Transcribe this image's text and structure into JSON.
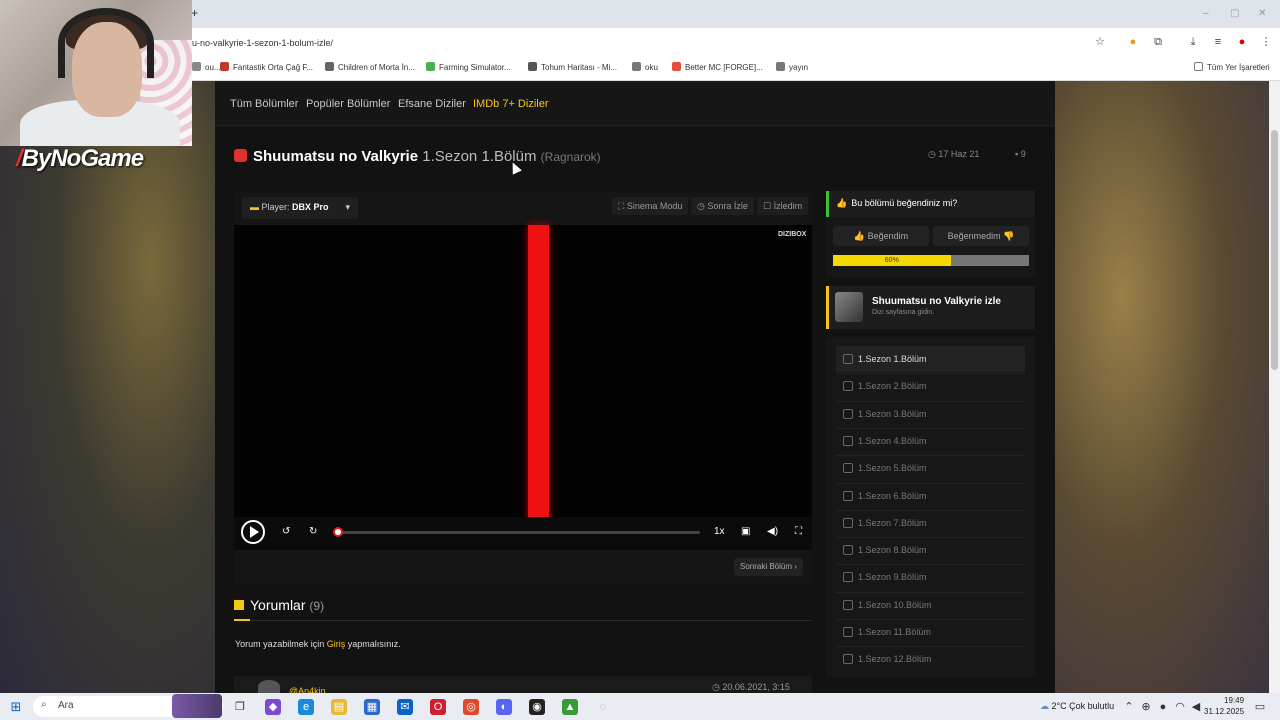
{
  "browser": {
    "url": "u-no-valkyrie-1-sezon-1-bolum-izle/",
    "bookmarks": [
      {
        "label": "ou...",
        "color": "#888888"
      },
      {
        "label": "Fantastik Orta Çağ F...",
        "color": "#c0392b"
      },
      {
        "label": "Children of Morta İn...",
        "color": "#666666"
      },
      {
        "label": "Farming Simulator...",
        "color": "#4caf50"
      },
      {
        "label": "Tohum Haritası - Mi...",
        "color": "#555555"
      },
      {
        "label": "oku",
        "color": "#777777"
      },
      {
        "label": "Better MC [FORGE]...",
        "color": "#e74c3c"
      },
      {
        "label": "yayın",
        "color": "#777777"
      }
    ],
    "all_bookmarks": "Tüm Yer İşaretleri"
  },
  "overlay": {
    "logo": "ByNoGame"
  },
  "nav": {
    "links": [
      "Tüm Bölümler",
      "Popüler Bölümler",
      "Efsane Diziler",
      "IMDb 7+ Diziler"
    ]
  },
  "episode": {
    "show": "Shuumatsu no Valkyrie",
    "season_ep": "1.Sezon 1.Bölüm",
    "subtitle": "(Ragnarok)",
    "date": "17 Haz 21",
    "comment_count": "9"
  },
  "player": {
    "label": "Player:",
    "name": "DBX Pro",
    "buttons": [
      "Sinema Modu",
      "Sonra İzle",
      "İzledim"
    ],
    "brand": "DIZIBOX",
    "speed": "1x",
    "next": "Sonraki Bölüm ›",
    "progress_fraction": 0.0
  },
  "comments": {
    "title": "Yorumlar",
    "count": "(9)",
    "note_before": "Yorum yazabilmek için ",
    "note_link": "Giriş",
    "note_after": " yapmalısınız.",
    "first_user": "@An4kin",
    "first_date": "20.06.2021, 3:15"
  },
  "rating": {
    "question": "Bu bölümü beğendiniz mi?",
    "like": "Beğendim",
    "dislike": "Beğenmedim",
    "percent_label": "60%",
    "percent": 60
  },
  "series_card": {
    "title": "Shuumatsu no Valkyrie izle",
    "sub": "Dizi sayfasına gidin."
  },
  "episodes": [
    "1.Sezon 1.Bölüm",
    "1.Sezon 2.Bölüm",
    "1.Sezon 3.Bölüm",
    "1.Sezon 4.Bölüm",
    "1.Sezon 5.Bölüm",
    "1.Sezon 6.Bölüm",
    "1.Sezon 7.Bölüm",
    "1.Sezon 8.Bölüm",
    "1.Sezon 9.Bölüm",
    "1.Sezon 10.Bölüm",
    "1.Sezon 11.Bölüm",
    "1.Sezon 12.Bölüm"
  ],
  "taskbar": {
    "search": "Ara",
    "weather": "2°C  Çok bulutlu",
    "time": "19:49",
    "date": "31.12.2025"
  }
}
